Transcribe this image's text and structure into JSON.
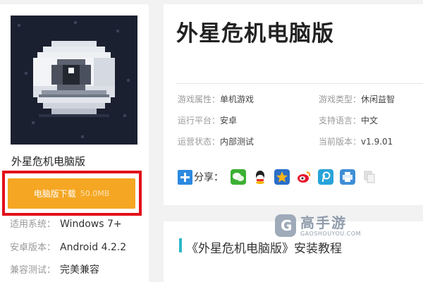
{
  "game": {
    "name": "外星危机电脑版",
    "title": "外星危机电脑版"
  },
  "download": {
    "label": "电脑版下载",
    "size": "50.0MB"
  },
  "system_info": [
    {
      "label": "适用系统：",
      "value": "Windows 7+"
    },
    {
      "label": "安卓版本：",
      "value": "Android 4.2.2"
    },
    {
      "label": "兼容测试：",
      "value": "完美兼容"
    }
  ],
  "details": [
    {
      "label": "游戏属性：",
      "value": "单机游戏"
    },
    {
      "label": "游戏类型：",
      "value": "休闲益智"
    },
    {
      "label": "运行平台：",
      "value": "安卓"
    },
    {
      "label": "支持语言：",
      "value": "中文"
    },
    {
      "label": "运营状态：",
      "value": "内部测试"
    },
    {
      "label": "当前版本：",
      "value": "v1.9.01"
    }
  ],
  "share": {
    "label": "分享：",
    "icons": [
      {
        "name": "wechat-icon",
        "color": "#3cb034"
      },
      {
        "name": "qq-icon",
        "color": "#ffffff"
      },
      {
        "name": "qzone-star-icon",
        "color": "#f6b41a"
      },
      {
        "name": "weibo-icon",
        "color": "#ffffff"
      },
      {
        "name": "tencent-weibo-icon",
        "color": "#27a3d9"
      },
      {
        "name": "print-icon",
        "color": "#3f8fd6"
      },
      {
        "name": "copy-icon",
        "color": "#cccccc"
      }
    ]
  },
  "section": {
    "title": "《外星危机电脑版》安装教程"
  },
  "watermark": {
    "brand": "高手游",
    "domain": "GAOSHOUYOU.COM"
  },
  "colors": {
    "download_button": "#f5a623",
    "highlight_frame": "#e3101a",
    "section_bar": "#2bb7c8"
  }
}
